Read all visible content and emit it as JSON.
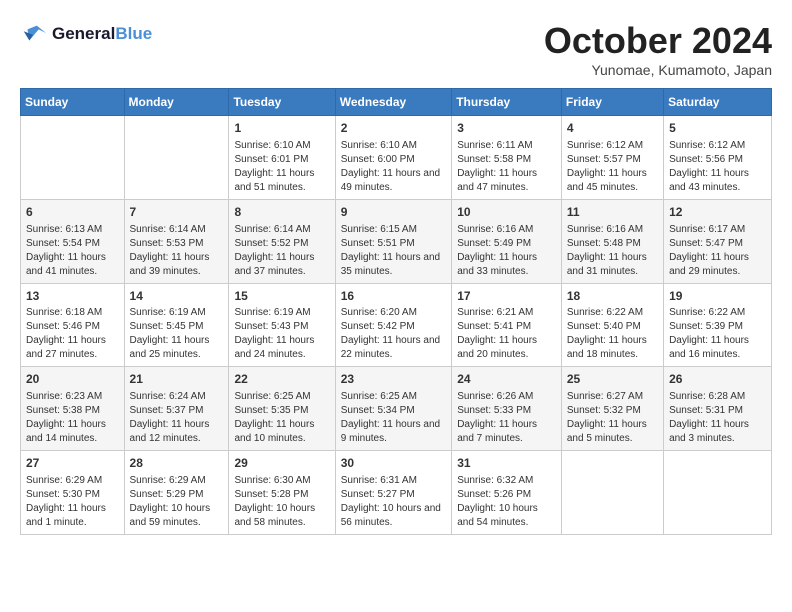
{
  "header": {
    "logo_line1": "General",
    "logo_line2": "Blue",
    "month": "October 2024",
    "location": "Yunomae, Kumamoto, Japan"
  },
  "weekdays": [
    "Sunday",
    "Monday",
    "Tuesday",
    "Wednesday",
    "Thursday",
    "Friday",
    "Saturday"
  ],
  "weeks": [
    [
      {
        "day": "",
        "info": ""
      },
      {
        "day": "",
        "info": ""
      },
      {
        "day": "1",
        "info": "Sunrise: 6:10 AM\nSunset: 6:01 PM\nDaylight: 11 hours and 51 minutes."
      },
      {
        "day": "2",
        "info": "Sunrise: 6:10 AM\nSunset: 6:00 PM\nDaylight: 11 hours and 49 minutes."
      },
      {
        "day": "3",
        "info": "Sunrise: 6:11 AM\nSunset: 5:58 PM\nDaylight: 11 hours and 47 minutes."
      },
      {
        "day": "4",
        "info": "Sunrise: 6:12 AM\nSunset: 5:57 PM\nDaylight: 11 hours and 45 minutes."
      },
      {
        "day": "5",
        "info": "Sunrise: 6:12 AM\nSunset: 5:56 PM\nDaylight: 11 hours and 43 minutes."
      }
    ],
    [
      {
        "day": "6",
        "info": "Sunrise: 6:13 AM\nSunset: 5:54 PM\nDaylight: 11 hours and 41 minutes."
      },
      {
        "day": "7",
        "info": "Sunrise: 6:14 AM\nSunset: 5:53 PM\nDaylight: 11 hours and 39 minutes."
      },
      {
        "day": "8",
        "info": "Sunrise: 6:14 AM\nSunset: 5:52 PM\nDaylight: 11 hours and 37 minutes."
      },
      {
        "day": "9",
        "info": "Sunrise: 6:15 AM\nSunset: 5:51 PM\nDaylight: 11 hours and 35 minutes."
      },
      {
        "day": "10",
        "info": "Sunrise: 6:16 AM\nSunset: 5:49 PM\nDaylight: 11 hours and 33 minutes."
      },
      {
        "day": "11",
        "info": "Sunrise: 6:16 AM\nSunset: 5:48 PM\nDaylight: 11 hours and 31 minutes."
      },
      {
        "day": "12",
        "info": "Sunrise: 6:17 AM\nSunset: 5:47 PM\nDaylight: 11 hours and 29 minutes."
      }
    ],
    [
      {
        "day": "13",
        "info": "Sunrise: 6:18 AM\nSunset: 5:46 PM\nDaylight: 11 hours and 27 minutes."
      },
      {
        "day": "14",
        "info": "Sunrise: 6:19 AM\nSunset: 5:45 PM\nDaylight: 11 hours and 25 minutes."
      },
      {
        "day": "15",
        "info": "Sunrise: 6:19 AM\nSunset: 5:43 PM\nDaylight: 11 hours and 24 minutes."
      },
      {
        "day": "16",
        "info": "Sunrise: 6:20 AM\nSunset: 5:42 PM\nDaylight: 11 hours and 22 minutes."
      },
      {
        "day": "17",
        "info": "Sunrise: 6:21 AM\nSunset: 5:41 PM\nDaylight: 11 hours and 20 minutes."
      },
      {
        "day": "18",
        "info": "Sunrise: 6:22 AM\nSunset: 5:40 PM\nDaylight: 11 hours and 18 minutes."
      },
      {
        "day": "19",
        "info": "Sunrise: 6:22 AM\nSunset: 5:39 PM\nDaylight: 11 hours and 16 minutes."
      }
    ],
    [
      {
        "day": "20",
        "info": "Sunrise: 6:23 AM\nSunset: 5:38 PM\nDaylight: 11 hours and 14 minutes."
      },
      {
        "day": "21",
        "info": "Sunrise: 6:24 AM\nSunset: 5:37 PM\nDaylight: 11 hours and 12 minutes."
      },
      {
        "day": "22",
        "info": "Sunrise: 6:25 AM\nSunset: 5:35 PM\nDaylight: 11 hours and 10 minutes."
      },
      {
        "day": "23",
        "info": "Sunrise: 6:25 AM\nSunset: 5:34 PM\nDaylight: 11 hours and 9 minutes."
      },
      {
        "day": "24",
        "info": "Sunrise: 6:26 AM\nSunset: 5:33 PM\nDaylight: 11 hours and 7 minutes."
      },
      {
        "day": "25",
        "info": "Sunrise: 6:27 AM\nSunset: 5:32 PM\nDaylight: 11 hours and 5 minutes."
      },
      {
        "day": "26",
        "info": "Sunrise: 6:28 AM\nSunset: 5:31 PM\nDaylight: 11 hours and 3 minutes."
      }
    ],
    [
      {
        "day": "27",
        "info": "Sunrise: 6:29 AM\nSunset: 5:30 PM\nDaylight: 11 hours and 1 minute."
      },
      {
        "day": "28",
        "info": "Sunrise: 6:29 AM\nSunset: 5:29 PM\nDaylight: 10 hours and 59 minutes."
      },
      {
        "day": "29",
        "info": "Sunrise: 6:30 AM\nSunset: 5:28 PM\nDaylight: 10 hours and 58 minutes."
      },
      {
        "day": "30",
        "info": "Sunrise: 6:31 AM\nSunset: 5:27 PM\nDaylight: 10 hours and 56 minutes."
      },
      {
        "day": "31",
        "info": "Sunrise: 6:32 AM\nSunset: 5:26 PM\nDaylight: 10 hours and 54 minutes."
      },
      {
        "day": "",
        "info": ""
      },
      {
        "day": "",
        "info": ""
      }
    ]
  ]
}
